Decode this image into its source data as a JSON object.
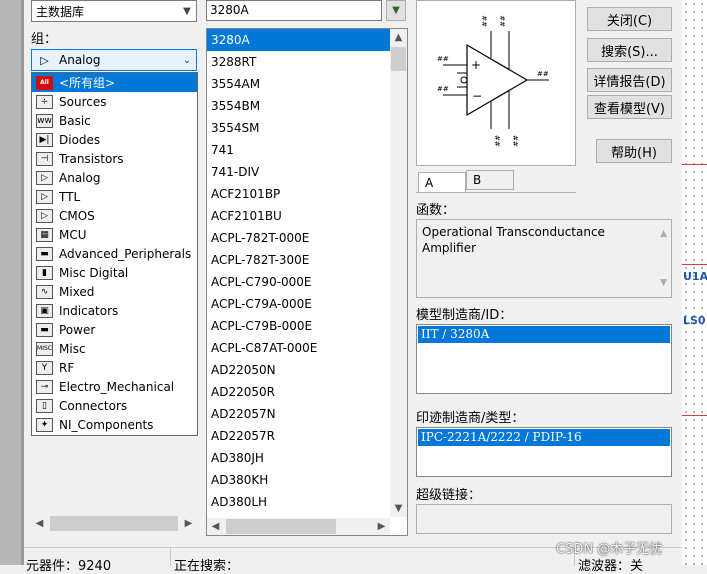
{
  "database": {
    "label": "主数据库"
  },
  "search_field": {
    "value": "3280A"
  },
  "group": {
    "label": "组：",
    "selected": "Analog",
    "dropdown_items": [
      {
        "label": "<所有组>",
        "icon": "all-groups-icon",
        "glyph": "All"
      },
      {
        "label": "Sources",
        "icon": "sources-icon",
        "glyph": "÷"
      },
      {
        "label": "Basic",
        "icon": "basic-icon",
        "glyph": "ww"
      },
      {
        "label": "Diodes",
        "icon": "diodes-icon",
        "glyph": "▶|"
      },
      {
        "label": "Transistors",
        "icon": "transistors-icon",
        "glyph": "⊣"
      },
      {
        "label": "Analog",
        "icon": "analog-icon",
        "glyph": "▷"
      },
      {
        "label": "TTL",
        "icon": "ttl-icon",
        "glyph": "▷"
      },
      {
        "label": "CMOS",
        "icon": "cmos-icon",
        "glyph": "▷"
      },
      {
        "label": "MCU",
        "icon": "mcu-icon",
        "glyph": "▦"
      },
      {
        "label": "Advanced_Peripherals",
        "icon": "advanced-peripherals-icon",
        "glyph": "▬"
      },
      {
        "label": "Misc Digital",
        "icon": "misc-digital-icon",
        "glyph": "▮"
      },
      {
        "label": "Mixed",
        "icon": "mixed-icon",
        "glyph": "∿"
      },
      {
        "label": "Indicators",
        "icon": "indicators-icon",
        "glyph": "▣"
      },
      {
        "label": "Power",
        "icon": "power-icon",
        "glyph": "▬"
      },
      {
        "label": "Misc",
        "icon": "misc-icon",
        "glyph": "MISC"
      },
      {
        "label": "RF",
        "icon": "rf-icon",
        "glyph": "Y"
      },
      {
        "label": "Electro_Mechanical",
        "icon": "electro-mechanical-icon",
        "glyph": "⊸"
      },
      {
        "label": "Connectors",
        "icon": "connectors-icon",
        "glyph": "▯"
      },
      {
        "label": "NI_Components",
        "icon": "ni-components-icon",
        "glyph": "✦"
      }
    ]
  },
  "components": [
    "3280A",
    "3288RT",
    "3554AM",
    "3554BM",
    "3554SM",
    "741",
    "741-DIV",
    "ACF2101BP",
    "ACF2101BU",
    "ACPL-782T-000E",
    "ACPL-782T-300E",
    "ACPL-C790-000E",
    "ACPL-C79A-000E",
    "ACPL-C79B-000E",
    "ACPL-C87AT-000E",
    "AD22050N",
    "AD22050R",
    "AD22057N",
    "AD22057R",
    "AD380JH",
    "AD380KH",
    "AD380LH"
  ],
  "buttons": {
    "close": "关闭(C)",
    "search": "搜索(S)...",
    "report": "详情报告(D)",
    "view_model": "查看模型(V)",
    "help": "帮助(H)"
  },
  "preview": {
    "pin_label": "##",
    "tabs": [
      "A",
      "B"
    ]
  },
  "function": {
    "label": "函数：",
    "text": "Operational Transconductance Amplifier"
  },
  "model_mfr": {
    "label": "模型制造商/ID：",
    "selected": "IIT / 3280A"
  },
  "footprint_mfr": {
    "label": "印迹制造商/类型：",
    "selected": "IPC-2221A/2222 / PDIP-16"
  },
  "hyperlink": {
    "label": "超级链接："
  },
  "statusbar": {
    "count": "元器件：9240",
    "searching": "正在搜索：",
    "filter": "滤波器：关"
  },
  "canvas_labels": [
    "U1A",
    "LS0"
  ],
  "watermark": "CSDN @木子无忧",
  "colors": {
    "selection": "#0078d7",
    "all_icon": "#d01010"
  }
}
